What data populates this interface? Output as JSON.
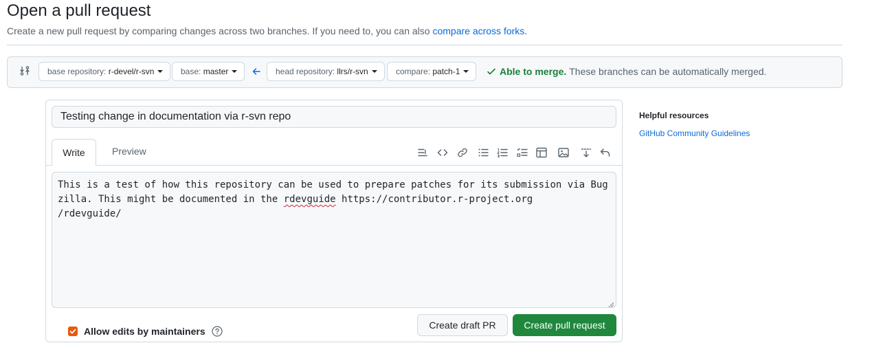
{
  "page": {
    "title": "Open a pull request",
    "subtitle_text": "Create a new pull request by comparing changes across two branches. If you need to, you can also ",
    "subtitle_link": "compare across forks."
  },
  "range": {
    "base_repo_label": "base repository:",
    "base_repo_value": "r-devel/r-svn",
    "base_label": "base:",
    "base_value": "master",
    "head_repo_label": "head repository:",
    "head_repo_value": "llrs/r-svn",
    "compare_label": "compare:",
    "compare_value": "patch-1",
    "merge_ok": "Able to merge.",
    "merge_note": "These branches can be automatically merged."
  },
  "form": {
    "title_value": "Testing change in documentation via r-svn repo",
    "tab_write": "Write",
    "tab_preview": "Preview",
    "body_before": "This is a test of how this repository can be used to prepare patches for its submission via Bugzilla. This might be documented in the ",
    "body_misspelled": "rdevguide",
    "body_after": " https://contributor.r-project.org\n/rdevguide/",
    "allow_edits_label": "Allow edits by maintainers",
    "allow_edits_checked": true,
    "draft_button": "Create draft PR",
    "create_button": "Create pull request"
  },
  "toolbar": [
    "heading-icon",
    "code-icon",
    "link-icon",
    "unordered-list-icon",
    "ordered-list-icon",
    "task-list-icon",
    "table-icon",
    "image-icon",
    "mention-icon",
    "undo-icon"
  ],
  "sidebar": {
    "heading": "Helpful resources",
    "link": "GitHub Community Guidelines"
  },
  "colors": {
    "accent_link": "#0969da",
    "success": "#1a7f37",
    "primary_button": "#1f883d",
    "checkbox": "#e8590c"
  }
}
